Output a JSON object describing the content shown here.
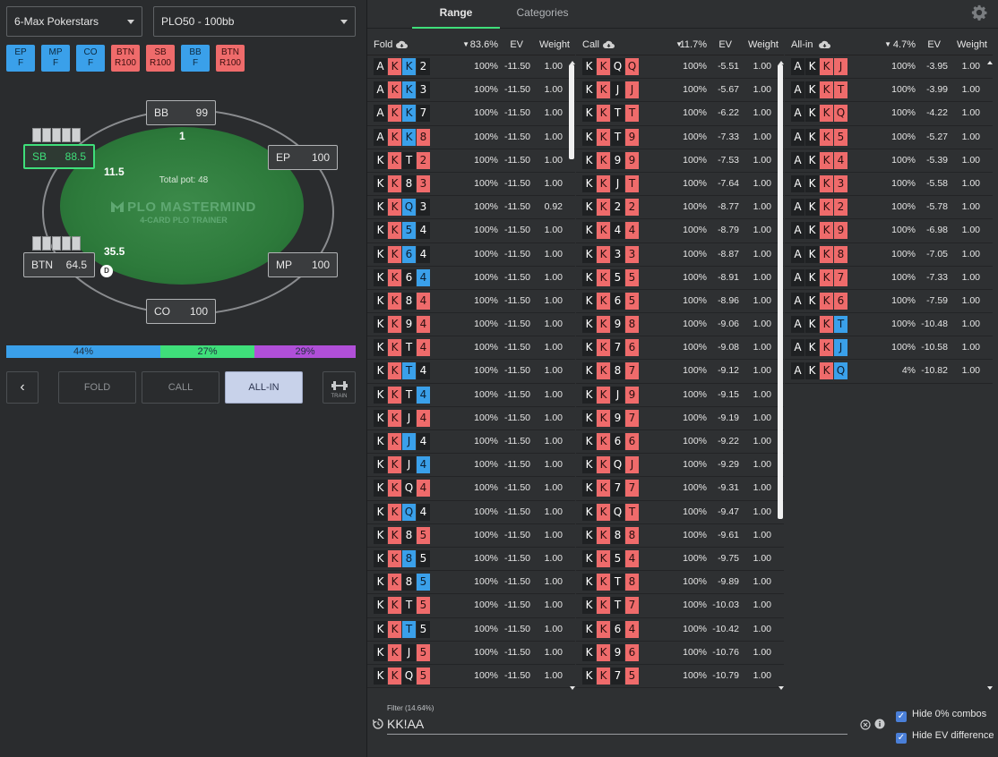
{
  "header": {
    "site_select": "6-Max Pokerstars",
    "game_select": "PLO50 - 100bb"
  },
  "positions": [
    {
      "pos": "EP",
      "act": "F",
      "kind": "f"
    },
    {
      "pos": "MP",
      "act": "F",
      "kind": "f"
    },
    {
      "pos": "CO",
      "act": "F",
      "kind": "f"
    },
    {
      "pos": "BTN",
      "act": "R100",
      "kind": "r"
    },
    {
      "pos": "SB",
      "act": "R100",
      "kind": "r"
    },
    {
      "pos": "BB",
      "act": "F",
      "kind": "f"
    },
    {
      "pos": "BTN",
      "act": "R100",
      "kind": "r"
    }
  ],
  "table": {
    "total_pot": "Total pot: 48",
    "logo_main": "PLO MASTERMIND",
    "logo_sub": "4-CARD PLO TRAINER",
    "seats": {
      "bb": {
        "name": "BB",
        "stack": "99"
      },
      "sb": {
        "name": "SB",
        "stack": "88.5"
      },
      "ep": {
        "name": "EP",
        "stack": "100"
      },
      "btn": {
        "name": "BTN",
        "stack": "64.5"
      },
      "mp": {
        "name": "MP",
        "stack": "100"
      },
      "co": {
        "name": "CO",
        "stack": "100"
      }
    },
    "bets": {
      "bb": "1",
      "sb": "11.5",
      "btn": "35.5"
    },
    "dealer": "D"
  },
  "frequencies": {
    "fold": "44%",
    "call": "27%",
    "allin": "29%",
    "fold_frac": 0.44,
    "call_frac": 0.27,
    "allin_frac": 0.29,
    "fold_color": "#3aa0ea",
    "call_color": "#3fdf7a",
    "allin_color": "#b04fd8"
  },
  "actions": {
    "back": "‹",
    "fold": "FOLD",
    "call": "CALL",
    "allin": "ALL-IN",
    "train": "TRAIN"
  },
  "tabs": {
    "range": "Range",
    "categories": "Categories"
  },
  "columns": [
    {
      "title": "Fold",
      "freq": "83.6%",
      "ev_label": "EV",
      "weight_label": "Weight",
      "rows": [
        {
          "cards": [
            "As",
            "Kh",
            "Kd",
            "2s"
          ],
          "pct": "100%",
          "ev": "-11.50",
          "w": "1.00"
        },
        {
          "cards": [
            "As",
            "Kh",
            "Kd",
            "3s"
          ],
          "pct": "100%",
          "ev": "-11.50",
          "w": "1.00"
        },
        {
          "cards": [
            "As",
            "Kh",
            "Kd",
            "7s"
          ],
          "pct": "100%",
          "ev": "-11.50",
          "w": "1.00"
        },
        {
          "cards": [
            "As",
            "Kh",
            "Kd",
            "8h"
          ],
          "pct": "100%",
          "ev": "-11.50",
          "w": "1.00"
        },
        {
          "cards": [
            "Ks",
            "Kh",
            "Ts",
            "2h"
          ],
          "pct": "100%",
          "ev": "-11.50",
          "w": "1.00"
        },
        {
          "cards": [
            "Ks",
            "Kh",
            "8s",
            "3h"
          ],
          "pct": "100%",
          "ev": "-11.50",
          "w": "1.00"
        },
        {
          "cards": [
            "Ks",
            "Kh",
            "Qd",
            "3s"
          ],
          "pct": "100%",
          "ev": "-11.50",
          "w": "0.92"
        },
        {
          "cards": [
            "Ks",
            "Kh",
            "5d",
            "4s"
          ],
          "pct": "100%",
          "ev": "-11.50",
          "w": "1.00"
        },
        {
          "cards": [
            "Ks",
            "Kh",
            "6d",
            "4s"
          ],
          "pct": "100%",
          "ev": "-11.50",
          "w": "1.00"
        },
        {
          "cards": [
            "Ks",
            "Kh",
            "6s",
            "4d"
          ],
          "pct": "100%",
          "ev": "-11.50",
          "w": "1.00"
        },
        {
          "cards": [
            "Ks",
            "Kh",
            "8s",
            "4h"
          ],
          "pct": "100%",
          "ev": "-11.50",
          "w": "1.00"
        },
        {
          "cards": [
            "Ks",
            "Kh",
            "9s",
            "4h"
          ],
          "pct": "100%",
          "ev": "-11.50",
          "w": "1.00"
        },
        {
          "cards": [
            "Ks",
            "Kh",
            "Ts",
            "4h"
          ],
          "pct": "100%",
          "ev": "-11.50",
          "w": "1.00"
        },
        {
          "cards": [
            "Ks",
            "Kh",
            "Td",
            "4s"
          ],
          "pct": "100%",
          "ev": "-11.50",
          "w": "1.00"
        },
        {
          "cards": [
            "Ks",
            "Kh",
            "Ts",
            "4d"
          ],
          "pct": "100%",
          "ev": "-11.50",
          "w": "1.00"
        },
        {
          "cards": [
            "Ks",
            "Kh",
            "Js",
            "4h"
          ],
          "pct": "100%",
          "ev": "-11.50",
          "w": "1.00"
        },
        {
          "cards": [
            "Ks",
            "Kh",
            "Jd",
            "4s"
          ],
          "pct": "100%",
          "ev": "-11.50",
          "w": "1.00"
        },
        {
          "cards": [
            "Ks",
            "Kh",
            "Js",
            "4d"
          ],
          "pct": "100%",
          "ev": "-11.50",
          "w": "1.00"
        },
        {
          "cards": [
            "Ks",
            "Kh",
            "Qs",
            "4h"
          ],
          "pct": "100%",
          "ev": "-11.50",
          "w": "1.00"
        },
        {
          "cards": [
            "Ks",
            "Kh",
            "Qd",
            "4s"
          ],
          "pct": "100%",
          "ev": "-11.50",
          "w": "1.00"
        },
        {
          "cards": [
            "Ks",
            "Kh",
            "8s",
            "5h"
          ],
          "pct": "100%",
          "ev": "-11.50",
          "w": "1.00"
        },
        {
          "cards": [
            "Ks",
            "Kh",
            "8d",
            "5s"
          ],
          "pct": "100%",
          "ev": "-11.50",
          "w": "1.00"
        },
        {
          "cards": [
            "Ks",
            "Kh",
            "8s",
            "5d"
          ],
          "pct": "100%",
          "ev": "-11.50",
          "w": "1.00"
        },
        {
          "cards": [
            "Ks",
            "Kh",
            "Ts",
            "5h"
          ],
          "pct": "100%",
          "ev": "-11.50",
          "w": "1.00"
        },
        {
          "cards": [
            "Ks",
            "Kh",
            "Td",
            "5s"
          ],
          "pct": "100%",
          "ev": "-11.50",
          "w": "1.00"
        },
        {
          "cards": [
            "Ks",
            "Kh",
            "Js",
            "5h"
          ],
          "pct": "100%",
          "ev": "-11.50",
          "w": "1.00"
        },
        {
          "cards": [
            "Ks",
            "Kh",
            "Qs",
            "5h"
          ],
          "pct": "100%",
          "ev": "-11.50",
          "w": "1.00"
        }
      ]
    },
    {
      "title": "Call",
      "freq": "11.7%",
      "ev_label": "EV",
      "weight_label": "Weight",
      "rows": [
        {
          "cards": [
            "Ks",
            "Kh",
            "Qs",
            "Qh"
          ],
          "pct": "100%",
          "ev": "-5.51",
          "w": "1.00"
        },
        {
          "cards": [
            "Ks",
            "Kh",
            "Js",
            "Jh"
          ],
          "pct": "100%",
          "ev": "-5.67",
          "w": "1.00"
        },
        {
          "cards": [
            "Ks",
            "Kh",
            "Ts",
            "Th"
          ],
          "pct": "100%",
          "ev": "-6.22",
          "w": "1.00"
        },
        {
          "cards": [
            "Ks",
            "Kh",
            "Ts",
            "9h"
          ],
          "pct": "100%",
          "ev": "-7.33",
          "w": "1.00"
        },
        {
          "cards": [
            "Ks",
            "Kh",
            "9s",
            "9h"
          ],
          "pct": "100%",
          "ev": "-7.53",
          "w": "1.00"
        },
        {
          "cards": [
            "Ks",
            "Kh",
            "Js",
            "Th"
          ],
          "pct": "100%",
          "ev": "-7.64",
          "w": "1.00"
        },
        {
          "cards": [
            "Ks",
            "Kh",
            "2s",
            "2h"
          ],
          "pct": "100%",
          "ev": "-8.77",
          "w": "1.00"
        },
        {
          "cards": [
            "Ks",
            "Kh",
            "4s",
            "4h"
          ],
          "pct": "100%",
          "ev": "-8.79",
          "w": "1.00"
        },
        {
          "cards": [
            "Ks",
            "Kh",
            "3s",
            "3h"
          ],
          "pct": "100%",
          "ev": "-8.87",
          "w": "1.00"
        },
        {
          "cards": [
            "Ks",
            "Kh",
            "5s",
            "5h"
          ],
          "pct": "100%",
          "ev": "-8.91",
          "w": "1.00"
        },
        {
          "cards": [
            "Ks",
            "Kh",
            "6s",
            "5h"
          ],
          "pct": "100%",
          "ev": "-8.96",
          "w": "1.00"
        },
        {
          "cards": [
            "Ks",
            "Kh",
            "9s",
            "8h"
          ],
          "pct": "100%",
          "ev": "-9.06",
          "w": "1.00"
        },
        {
          "cards": [
            "Ks",
            "Kh",
            "7s",
            "6h"
          ],
          "pct": "100%",
          "ev": "-9.08",
          "w": "1.00"
        },
        {
          "cards": [
            "Ks",
            "Kh",
            "8s",
            "7h"
          ],
          "pct": "100%",
          "ev": "-9.12",
          "w": "1.00"
        },
        {
          "cards": [
            "Ks",
            "Kh",
            "Js",
            "9h"
          ],
          "pct": "100%",
          "ev": "-9.15",
          "w": "1.00"
        },
        {
          "cards": [
            "Ks",
            "Kh",
            "9s",
            "7h"
          ],
          "pct": "100%",
          "ev": "-9.19",
          "w": "1.00"
        },
        {
          "cards": [
            "Ks",
            "Kh",
            "6s",
            "6h"
          ],
          "pct": "100%",
          "ev": "-9.22",
          "w": "1.00"
        },
        {
          "cards": [
            "Ks",
            "Kh",
            "Qs",
            "Jh"
          ],
          "pct": "100%",
          "ev": "-9.29",
          "w": "1.00"
        },
        {
          "cards": [
            "Ks",
            "Kh",
            "7s",
            "7h"
          ],
          "pct": "100%",
          "ev": "-9.31",
          "w": "1.00"
        },
        {
          "cards": [
            "Ks",
            "Kh",
            "Qs",
            "Th"
          ],
          "pct": "100%",
          "ev": "-9.47",
          "w": "1.00"
        },
        {
          "cards": [
            "Ks",
            "Kh",
            "8s",
            "8h"
          ],
          "pct": "100%",
          "ev": "-9.61",
          "w": "1.00"
        },
        {
          "cards": [
            "Ks",
            "Kh",
            "5s",
            "4h"
          ],
          "pct": "100%",
          "ev": "-9.75",
          "w": "1.00"
        },
        {
          "cards": [
            "Ks",
            "Kh",
            "Ts",
            "8h"
          ],
          "pct": "100%",
          "ev": "-9.89",
          "w": "1.00"
        },
        {
          "cards": [
            "Ks",
            "Kh",
            "Ts",
            "7h"
          ],
          "pct": "100%",
          "ev": "-10.03",
          "w": "1.00"
        },
        {
          "cards": [
            "Ks",
            "Kh",
            "6s",
            "4h"
          ],
          "pct": "100%",
          "ev": "-10.42",
          "w": "1.00"
        },
        {
          "cards": [
            "Ks",
            "Kh",
            "9s",
            "6h"
          ],
          "pct": "100%",
          "ev": "-10.76",
          "w": "1.00"
        },
        {
          "cards": [
            "Ks",
            "Kh",
            "7s",
            "5h"
          ],
          "pct": "100%",
          "ev": "-10.79",
          "w": "1.00"
        }
      ]
    },
    {
      "title": "All-in",
      "freq": "4.7%",
      "ev_label": "EV",
      "weight_label": "Weight",
      "rows": [
        {
          "cards": [
            "As",
            "Ks",
            "Kh",
            "Jh"
          ],
          "pct": "100%",
          "ev": "-3.95",
          "w": "1.00"
        },
        {
          "cards": [
            "As",
            "Ks",
            "Kh",
            "Th"
          ],
          "pct": "100%",
          "ev": "-3.99",
          "w": "1.00"
        },
        {
          "cards": [
            "As",
            "Ks",
            "Kh",
            "Qh"
          ],
          "pct": "100%",
          "ev": "-4.22",
          "w": "1.00"
        },
        {
          "cards": [
            "As",
            "Ks",
            "Kh",
            "5h"
          ],
          "pct": "100%",
          "ev": "-5.27",
          "w": "1.00"
        },
        {
          "cards": [
            "As",
            "Ks",
            "Kh",
            "4h"
          ],
          "pct": "100%",
          "ev": "-5.39",
          "w": "1.00"
        },
        {
          "cards": [
            "As",
            "Ks",
            "Kh",
            "3h"
          ],
          "pct": "100%",
          "ev": "-5.58",
          "w": "1.00"
        },
        {
          "cards": [
            "As",
            "Ks",
            "Kh",
            "2h"
          ],
          "pct": "100%",
          "ev": "-5.78",
          "w": "1.00"
        },
        {
          "cards": [
            "As",
            "Ks",
            "Kh",
            "9h"
          ],
          "pct": "100%",
          "ev": "-6.98",
          "w": "1.00"
        },
        {
          "cards": [
            "As",
            "Ks",
            "Kh",
            "8h"
          ],
          "pct": "100%",
          "ev": "-7.05",
          "w": "1.00"
        },
        {
          "cards": [
            "As",
            "Ks",
            "Kh",
            "7h"
          ],
          "pct": "100%",
          "ev": "-7.33",
          "w": "1.00"
        },
        {
          "cards": [
            "As",
            "Ks",
            "Kh",
            "6h"
          ],
          "pct": "100%",
          "ev": "-7.59",
          "w": "1.00"
        },
        {
          "cards": [
            "As",
            "Ks",
            "Kh",
            "Td"
          ],
          "pct": "100%",
          "ev": "-10.48",
          "w": "1.00"
        },
        {
          "cards": [
            "As",
            "Ks",
            "Kh",
            "Jd"
          ],
          "pct": "100%",
          "ev": "-10.58",
          "w": "1.00"
        },
        {
          "cards": [
            "As",
            "Ks",
            "Kh",
            "Qd"
          ],
          "pct": "4%",
          "ev": "-10.82",
          "w": "1.00"
        }
      ]
    }
  ],
  "filter": {
    "label": "Filter (14.64%)",
    "value": "KK!AA"
  },
  "options": {
    "hide_zero": "Hide 0% combos",
    "hide_ev": "Hide EV difference"
  }
}
